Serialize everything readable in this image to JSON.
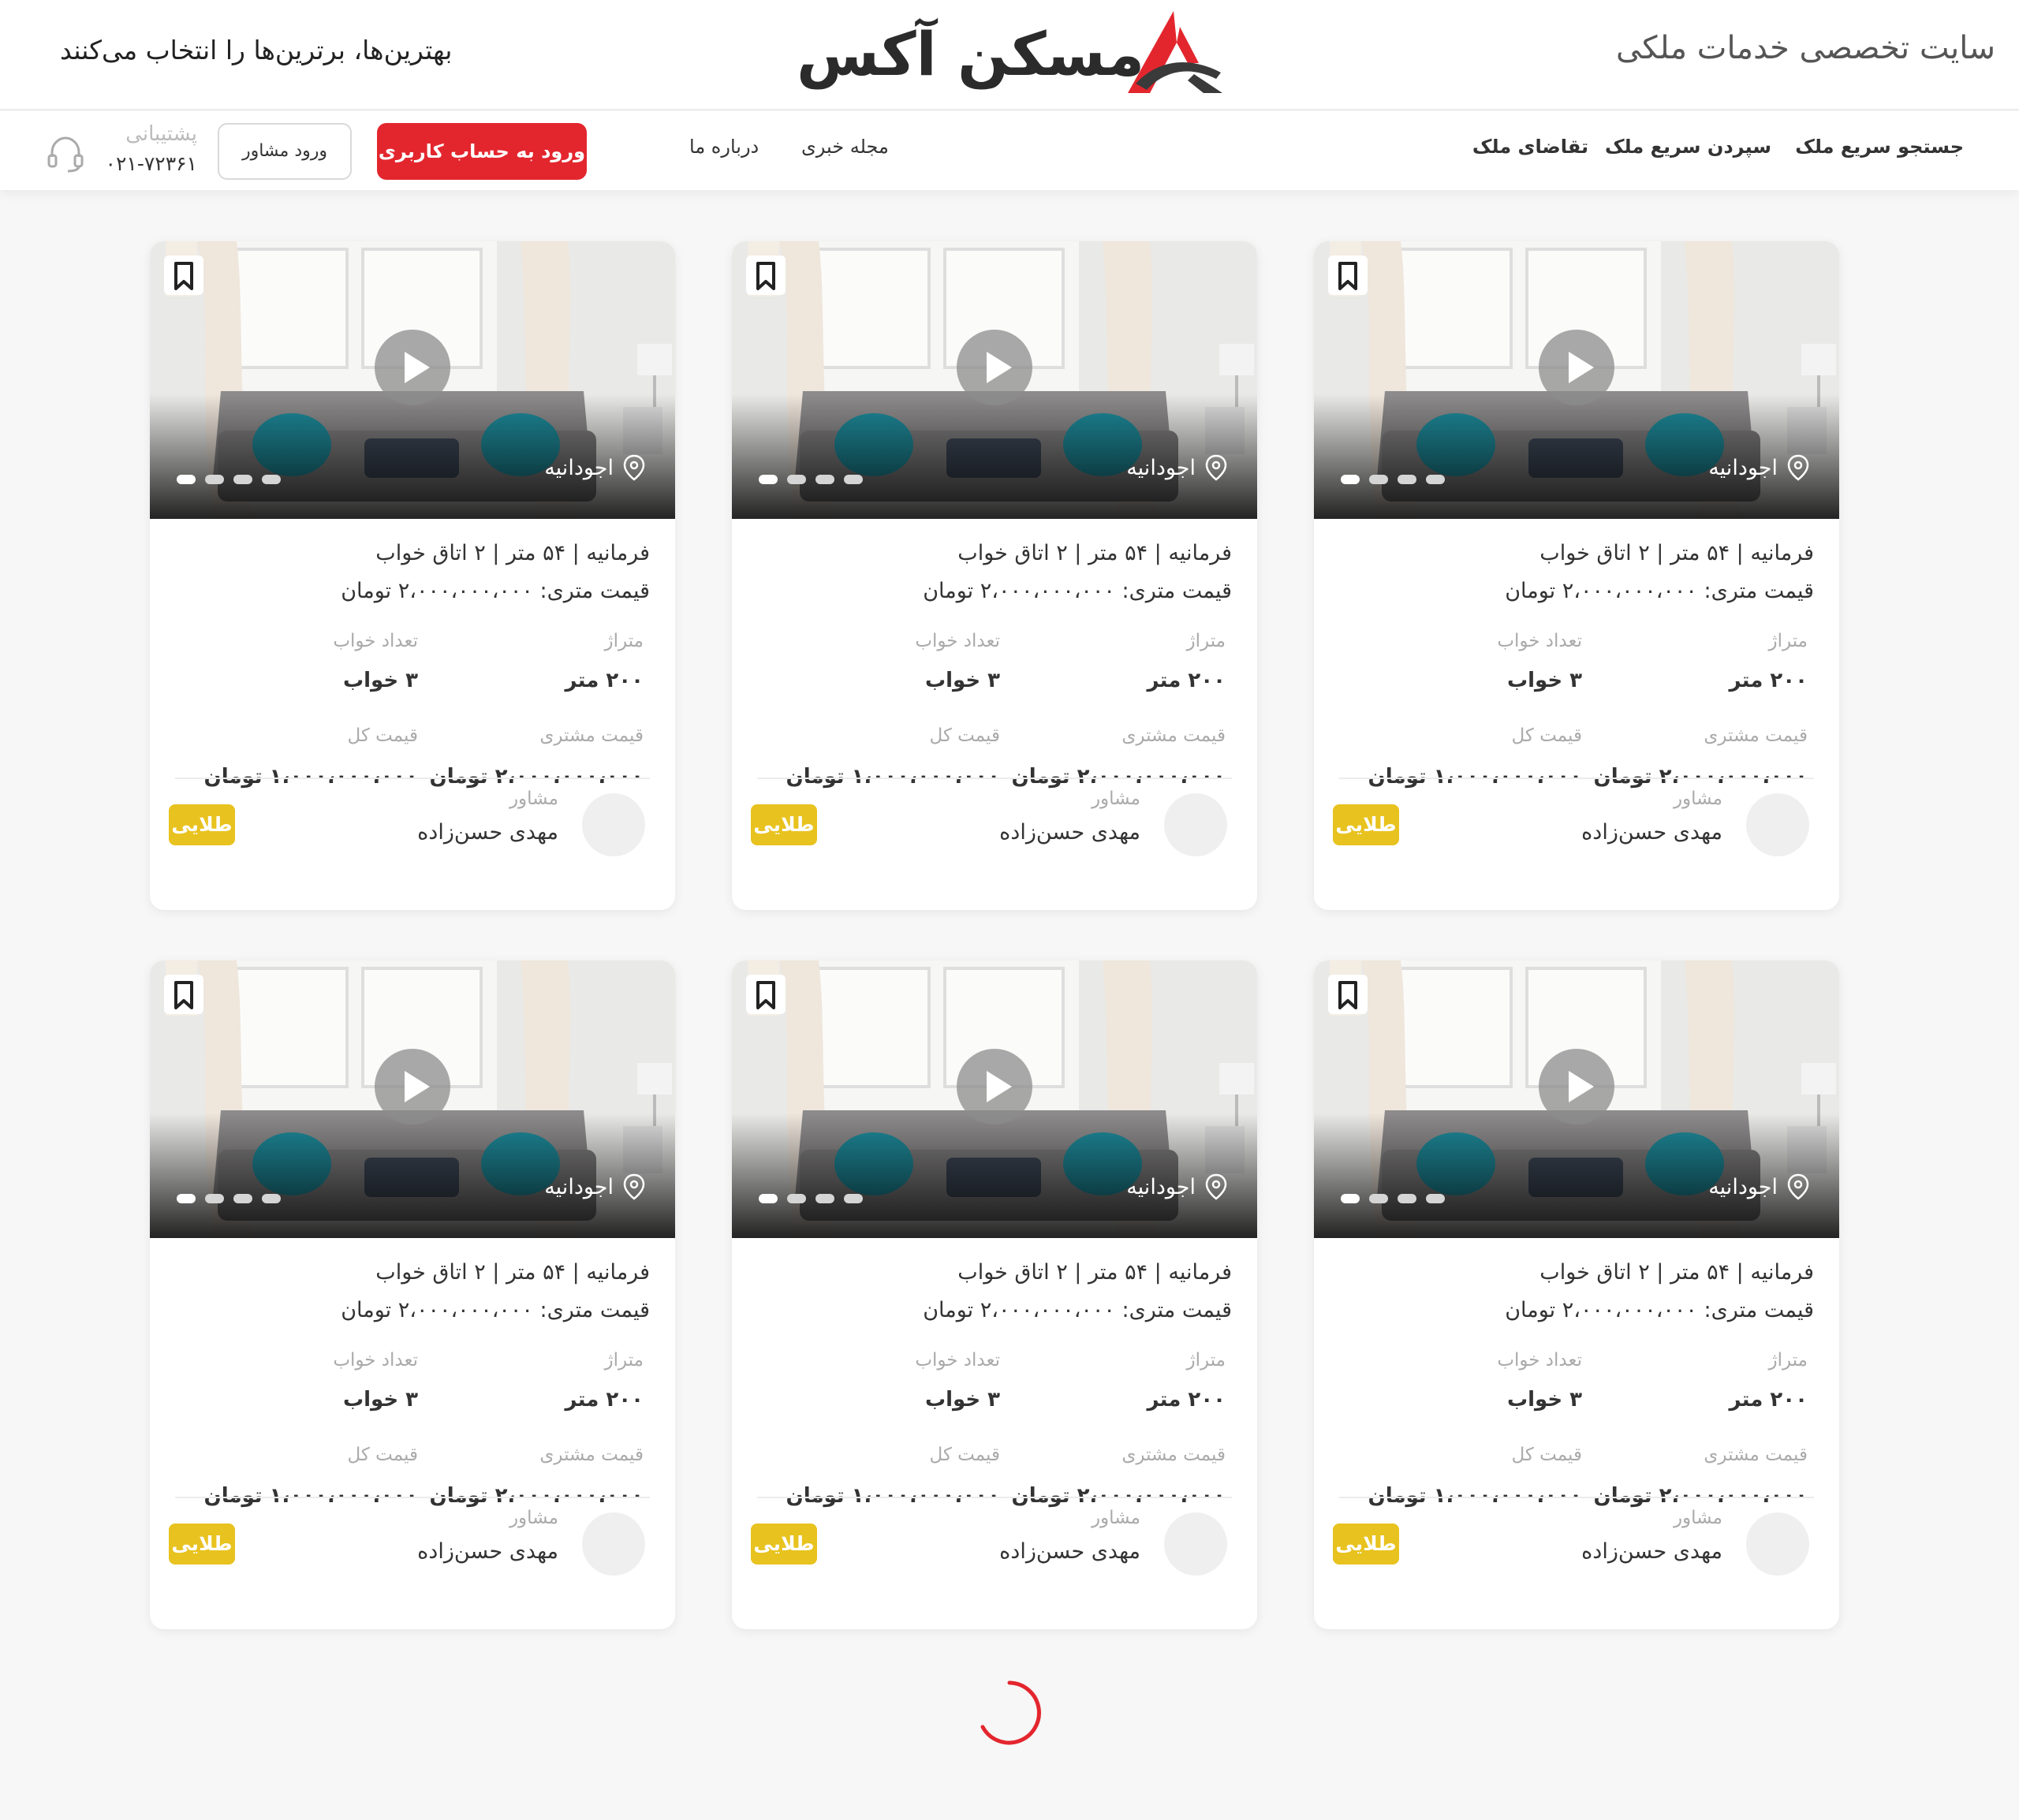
{
  "header": {
    "tagline_right": "سایت تخصصی خدمات ملکی",
    "brand_name": "مسکن آکس",
    "tagline_left": "بهترین‌ها، برترین‌ها را انتخاب می‌کنند",
    "brand_color": "#e3262e"
  },
  "nav": {
    "items": [
      "جستجو سریع ملک",
      "سپردن سریع ملک",
      "تقاضای ملک",
      "مجله خبری",
      "درباره ما"
    ],
    "login_button": "ورود به حساب کاربری",
    "agent_button": "ورود مشاور",
    "support_label": "پشتیبانی",
    "support_phone": "۰۲۱-۷۲۳۶۱"
  },
  "cards": [
    {
      "location": "اجودانیه",
      "summary": "فرمانیه  |  ۵۴ متر  |  ۲ اتاق خواب",
      "price_per_meter": "قیمت متری: ۲،۰۰۰،۰۰۰،۰۰۰ تومان",
      "area_label": "متراژ",
      "area_value": "۲۰۰ متر",
      "bedrooms_label": "تعداد خواب",
      "bedrooms_value": "۳ خواب",
      "customer_price_label": "قیمت مشتری",
      "customer_price_value": "۲،۰۰۰،۰۰۰،۰۰۰ تومان",
      "total_price_label": "قیمت کل",
      "total_price_value": "۱،۰۰۰،۰۰۰،۰۰۰ تومان",
      "agent_label": "مشاور",
      "agent_name": "مهدی حسن‌زاده",
      "badge": "طلایی",
      "photo_dots": 4,
      "active_dot": 0
    },
    {
      "location": "اجودانیه",
      "summary": "فرمانیه  |  ۵۴ متر  |  ۲ اتاق خواب",
      "price_per_meter": "قیمت متری: ۲،۰۰۰،۰۰۰،۰۰۰ تومان",
      "area_label": "متراژ",
      "area_value": "۲۰۰ متر",
      "bedrooms_label": "تعداد خواب",
      "bedrooms_value": "۳ خواب",
      "customer_price_label": "قیمت مشتری",
      "customer_price_value": "۲،۰۰۰،۰۰۰،۰۰۰ تومان",
      "total_price_label": "قیمت کل",
      "total_price_value": "۱،۰۰۰،۰۰۰،۰۰۰ تومان",
      "agent_label": "مشاور",
      "agent_name": "مهدی حسن‌زاده",
      "badge": "طلایی",
      "photo_dots": 4,
      "active_dot": 0
    },
    {
      "location": "اجودانیه",
      "summary": "فرمانیه  |  ۵۴ متر  |  ۲ اتاق خواب",
      "price_per_meter": "قیمت متری: ۲،۰۰۰،۰۰۰،۰۰۰ تومان",
      "area_label": "متراژ",
      "area_value": "۲۰۰ متر",
      "bedrooms_label": "تعداد خواب",
      "bedrooms_value": "۳ خواب",
      "customer_price_label": "قیمت مشتری",
      "customer_price_value": "۲،۰۰۰،۰۰۰،۰۰۰ تومان",
      "total_price_label": "قیمت کل",
      "total_price_value": "۱،۰۰۰،۰۰۰،۰۰۰ تومان",
      "agent_label": "مشاور",
      "agent_name": "مهدی حسن‌زاده",
      "badge": "طلایی",
      "photo_dots": 4,
      "active_dot": 0
    },
    {
      "location": "اجودانیه",
      "summary": "فرمانیه  |  ۵۴ متر  |  ۲ اتاق خواب",
      "price_per_meter": "قیمت متری: ۲،۰۰۰،۰۰۰،۰۰۰ تومان",
      "area_label": "متراژ",
      "area_value": "۲۰۰ متر",
      "bedrooms_label": "تعداد خواب",
      "bedrooms_value": "۳ خواب",
      "customer_price_label": "قیمت مشتری",
      "customer_price_value": "۲،۰۰۰،۰۰۰،۰۰۰ تومان",
      "total_price_label": "قیمت کل",
      "total_price_value": "۱،۰۰۰،۰۰۰،۰۰۰ تومان",
      "agent_label": "مشاور",
      "agent_name": "مهدی حسن‌زاده",
      "badge": "طلایی",
      "photo_dots": 4,
      "active_dot": 0
    },
    {
      "location": "اجودانیه",
      "summary": "فرمانیه  |  ۵۴ متر  |  ۲ اتاق خواب",
      "price_per_meter": "قیمت متری: ۲،۰۰۰،۰۰۰،۰۰۰ تومان",
      "area_label": "متراژ",
      "area_value": "۲۰۰ متر",
      "bedrooms_label": "تعداد خواب",
      "bedrooms_value": "۳ خواب",
      "customer_price_label": "قیمت مشتری",
      "customer_price_value": "۲،۰۰۰،۰۰۰،۰۰۰ تومان",
      "total_price_label": "قیمت کل",
      "total_price_value": "۱،۰۰۰،۰۰۰،۰۰۰ تومان",
      "agent_label": "مشاور",
      "agent_name": "مهدی حسن‌زاده",
      "badge": "طلایی",
      "photo_dots": 4,
      "active_dot": 0
    },
    {
      "location": "اجودانیه",
      "summary": "فرمانیه  |  ۵۴ متر  |  ۲ اتاق خواب",
      "price_per_meter": "قیمت متری: ۲،۰۰۰،۰۰۰،۰۰۰ تومان",
      "area_label": "متراژ",
      "area_value": "۲۰۰ متر",
      "bedrooms_label": "تعداد خواب",
      "bedrooms_value": "۳ خواب",
      "customer_price_label": "قیمت مشتری",
      "customer_price_value": "۲،۰۰۰،۰۰۰،۰۰۰ تومان",
      "total_price_label": "قیمت کل",
      "total_price_value": "۱،۰۰۰،۰۰۰،۰۰۰ تومان",
      "agent_label": "مشاور",
      "agent_name": "مهدی حسن‌زاده",
      "badge": "طلایی",
      "photo_dots": 4,
      "active_dot": 0
    }
  ],
  "colors": {
    "badge_gold": "#e8c21e",
    "accent_red": "#e3262e"
  },
  "icons": [
    "headset-icon",
    "bookmark-icon",
    "play-icon",
    "location-pin-icon",
    "loading-spinner-icon",
    "brand-logo"
  ]
}
